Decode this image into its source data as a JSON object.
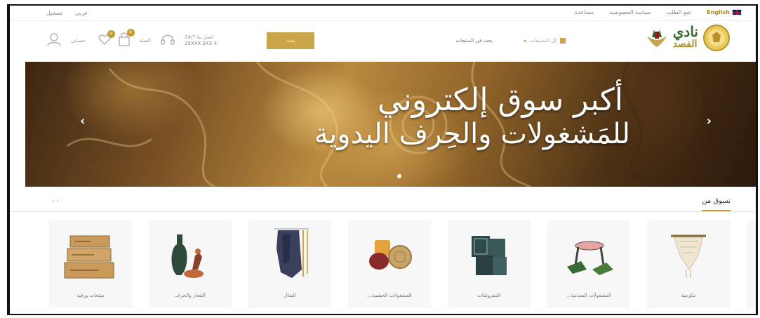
{
  "topbar": {
    "left_items": [
      "تسجيل",
      "عربي"
    ],
    "right_items": [
      "مساعدة",
      "سياسة الخصوصية",
      "تتبع الطلب"
    ],
    "language": "English"
  },
  "header": {
    "account_label": "حسابي",
    "cart_count": "0",
    "cart_label": "السلة",
    "wishlist_count": "0",
    "contact_label": "اتصل بنا 24/7",
    "contact_phone": "15XXX 2XX 4",
    "logo_line1": "نادي",
    "logo_line2": "الفصد"
  },
  "search": {
    "button_label": "بحث",
    "placeholder": "بحث في المنتجات",
    "category_label": "كل التصنيفات"
  },
  "hero": {
    "line1": "أكبر سوق إلكتروني",
    "line2": "للمَشغولات والحِرف اليدوية",
    "prev_arrow": "‹",
    "next_arrow": "›"
  },
  "shop_from": {
    "title": "تسوق من",
    "nav": "‹ ›"
  },
  "categories": [
    {
      "label": "منتجات ورقية",
      "icon": "boxes-icon"
    },
    {
      "label": "الفخار والخزف",
      "icon": "pottery-icon"
    },
    {
      "label": "الشال",
      "icon": "shawl-icon"
    },
    {
      "label": "المشغولات الخشبية...",
      "icon": "baskets-icon"
    },
    {
      "label": "المفروشات",
      "icon": "cushions-icon"
    },
    {
      "label": "المشغولات المعدنية...",
      "icon": "stool-icon"
    },
    {
      "label": "مكرمية",
      "icon": "macrame-icon"
    }
  ],
  "colors": {
    "gold": "#c49b2a",
    "button_gold": "#c9a44a",
    "logo_green": "#2f6b2f"
  }
}
